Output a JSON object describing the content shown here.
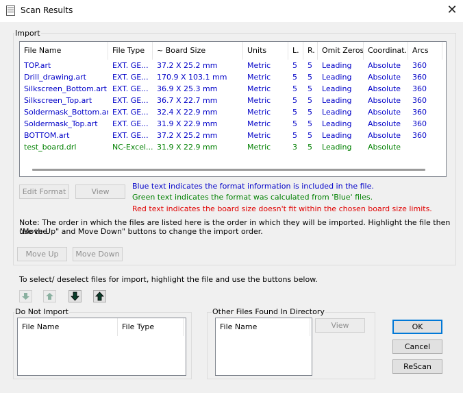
{
  "window": {
    "title": "Scan Results",
    "close_label": "✕"
  },
  "import_group": {
    "label": "Import",
    "columns": [
      "File Name",
      "File Type",
      "~ Board Size",
      "Units",
      "L.",
      "R.",
      "Omit Zeros",
      "Coordinat...",
      "Arcs"
    ],
    "rows": [
      {
        "color": "blue",
        "cells": [
          "TOP.art",
          "EXT. GE...",
          "37.2 X 25.2 mm",
          "Metric",
          "5",
          "5",
          "Leading",
          "Absolute",
          "360"
        ]
      },
      {
        "color": "blue",
        "cells": [
          "Drill_drawing.art",
          "EXT. GE...",
          "170.9 X 103.1 mm",
          "Metric",
          "5",
          "5",
          "Leading",
          "Absolute",
          "360"
        ]
      },
      {
        "color": "blue",
        "cells": [
          "Silkscreen_Bottom.art",
          "EXT. GE...",
          "36.9 X 25.3 mm",
          "Metric",
          "5",
          "5",
          "Leading",
          "Absolute",
          "360"
        ]
      },
      {
        "color": "blue",
        "cells": [
          "Silkscreen_Top.art",
          "EXT. GE...",
          "36.7 X 22.7 mm",
          "Metric",
          "5",
          "5",
          "Leading",
          "Absolute",
          "360"
        ]
      },
      {
        "color": "blue",
        "cells": [
          "Soldermask_Bottom.art",
          "EXT. GE...",
          "32.4 X 22.9 mm",
          "Metric",
          "5",
          "5",
          "Leading",
          "Absolute",
          "360"
        ]
      },
      {
        "color": "blue",
        "cells": [
          "Soldermask_Top.art",
          "EXT. GE...",
          "31.9 X 22.9 mm",
          "Metric",
          "5",
          "5",
          "Leading",
          "Absolute",
          "360"
        ]
      },
      {
        "color": "blue",
        "cells": [
          "BOTTOM.art",
          "EXT. GE...",
          "37.2 X 25.2 mm",
          "Metric",
          "5",
          "5",
          "Leading",
          "Absolute",
          "360"
        ]
      },
      {
        "color": "green",
        "cells": [
          "test_board.drl",
          "NC-Excel...",
          "31.9 X 22.9 mm",
          "Metric",
          "3",
          "5",
          "Leading",
          "Absolute",
          ""
        ]
      }
    ],
    "edit_format_label": "Edit Format",
    "view_label": "View",
    "legend_blue": "Blue text indicates the format information is included in the file.",
    "legend_green": "Green text indicates the format was calculated from 'Blue' files.",
    "legend_red": "Red text indicates the board size doesn't fit within the chosen board size limits.",
    "note_line1": "Note: The order in which the files are listed here is the order in which they will be imported.  Highlight the file then use the",
    "note_line2": "\"Move Up\" and Move Down\" buttons to change the import order.",
    "move_up_label": "Move Up",
    "move_down_label": "Move Down"
  },
  "select_instruction": "To select/ deselect files for import, highlight the file and use the buttons below.",
  "arrow_buttons": [
    "arrow-down-small-icon",
    "arrow-up-small-icon",
    "arrow-down-bold-icon",
    "arrow-up-bold-icon"
  ],
  "do_not_import": {
    "label": "Do Not Import",
    "columns": [
      "File Name",
      "File Type"
    ]
  },
  "other_files": {
    "label": "Other Files Found In Directory",
    "columns": [
      "File Name"
    ],
    "view_label": "View"
  },
  "actions": {
    "ok_label": "OK",
    "cancel_label": "Cancel",
    "rescan_label": "ReScan"
  },
  "colors": {
    "blue": "#0000c8",
    "green": "#008000",
    "red": "#e00000",
    "accent": "#0078d7"
  }
}
